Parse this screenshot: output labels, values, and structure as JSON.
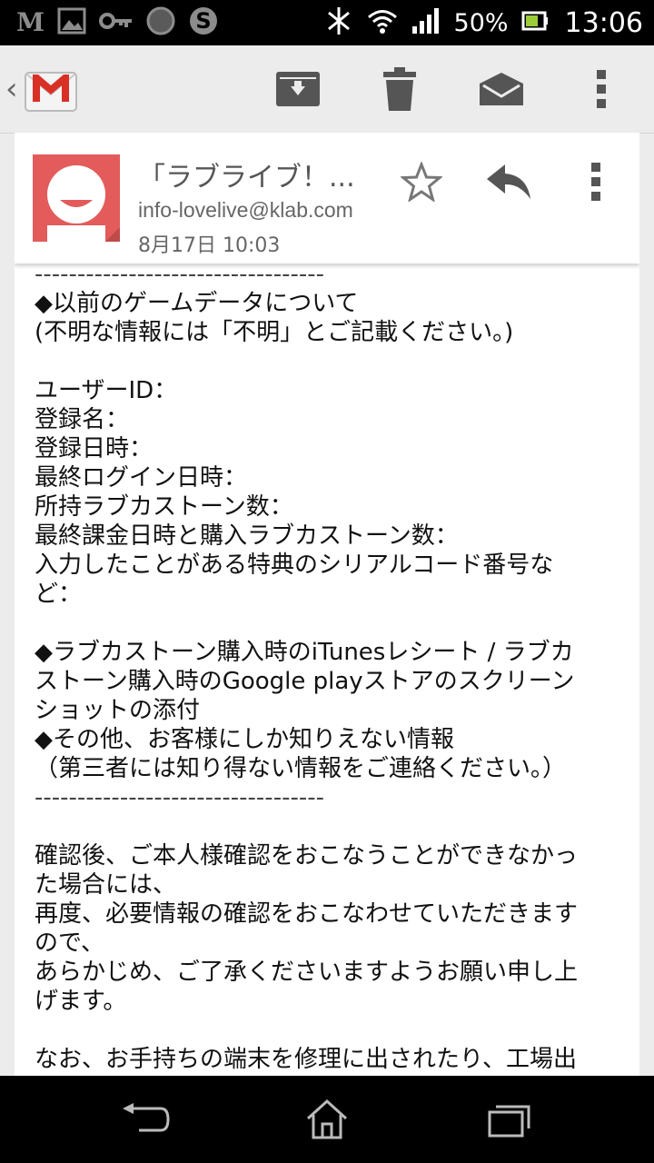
{
  "status_bar": {
    "battery_percent": "50%",
    "time": "13:06",
    "icons": [
      "m-icon",
      "image-icon",
      "key-icon",
      "circle-icon",
      "s-icon",
      "bluetooth-icon",
      "wifi-icon",
      "signal-icon",
      "battery-icon"
    ]
  },
  "action_bar": {
    "icons": [
      "gmail-logo",
      "archive-icon",
      "trash-icon",
      "mark-unread-icon",
      "overflow-menu-icon"
    ]
  },
  "email": {
    "subject": "「ラブライブ！...",
    "sender": "info-lovelive@klab.com",
    "date": "8月17日 10:03",
    "body_lines": [
      "----------------------------------",
      "◆以前のゲームデータについて",
      "(不明な情報には「不明」とご記載ください。)",
      "",
      "ユーザーID：",
      "登録名：",
      "登録日時：",
      "最終ログイン日時：",
      "所持ラブカストーン数：",
      "最終課金日時と購入ラブカストーン数：",
      "入力したことがある特典のシリアルコード番号な",
      "ど：",
      "",
      "◆ラブカストーン購入時のiTunesレシート / ラブカ",
      "ストーン購入時のGoogle playストアのスクリーン",
      "ショットの添付",
      "◆その他、お客様にしか知りえない情報",
      "（第三者には知り得ない情報をご連絡ください。）",
      "----------------------------------",
      "",
      "確認後、ご本人様確認をおこなうことができなかっ",
      "た場合には、",
      "再度、必要情報の確認をおこなわせていただきます",
      "ので、",
      "あらかじめ、ご了承くださいますようお願い申し上",
      "げます。",
      "",
      "なお、お手持ちの端末を修理に出されたり、工場出"
    ]
  },
  "nav_bar": {
    "icons": [
      "back-icon",
      "home-icon",
      "recent-apps-icon"
    ]
  }
}
